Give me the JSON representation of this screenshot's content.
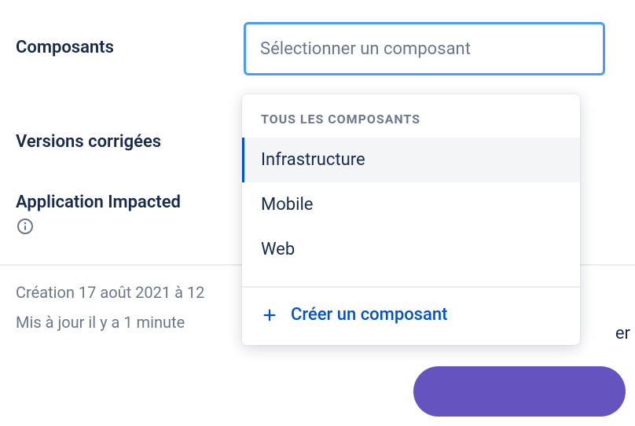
{
  "fields": {
    "components": {
      "label": "Composants",
      "placeholder": "Sélectionner un composant"
    },
    "fixVersions": {
      "label": "Versions corrigées"
    },
    "appImpacted": {
      "label": "Application Impacted"
    }
  },
  "dropdown": {
    "header": "TOUS LES COMPOSANTS",
    "options": [
      "Infrastructure",
      "Mobile",
      "Web"
    ],
    "createLabel": "Créer un composant"
  },
  "meta": {
    "created": "Création 17 août 2021 à 12",
    "updated": "Mis à jour il y a 1 minute"
  },
  "partial": {
    "er": "er"
  }
}
